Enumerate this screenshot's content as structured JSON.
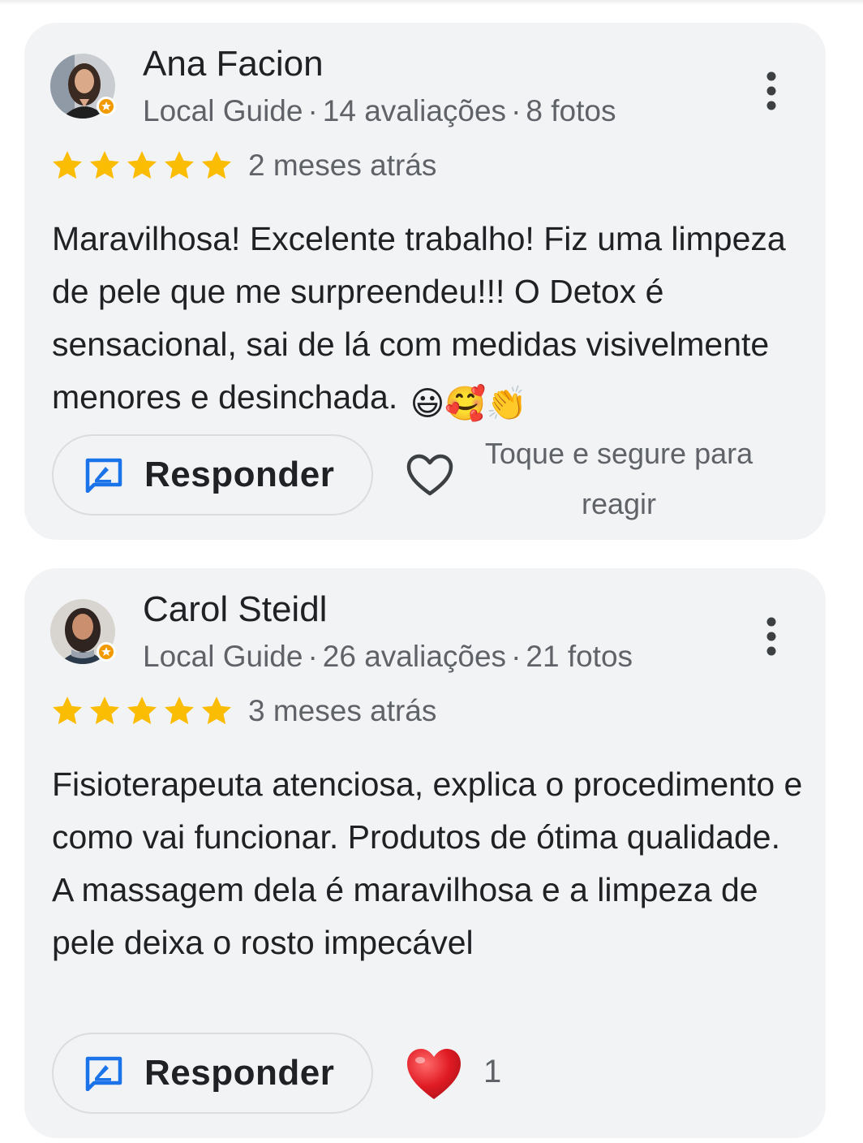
{
  "reviews": [
    {
      "name": "Ana Facion",
      "badge": "Local Guide",
      "reviews_count": "14 avaliações",
      "photos_count": "8 fotos",
      "rating": 5,
      "date": "2 meses atrás",
      "text": "Maravilhosa! Excelente trabalho! Fiz uma limpeza de pele que me surpreendeu!!! O Detox é sensacional, sai de lá com medidas visivelmente menores e desinchada.",
      "emojis": "😃🥰👏",
      "reply_label": "Responder",
      "react_hint": "Toque e segure para reagir"
    },
    {
      "name": "Carol Steidl",
      "badge": "Local Guide",
      "reviews_count": "26 avaliações",
      "photos_count": "21 fotos",
      "rating": 5,
      "date": "3 meses atrás",
      "text": "Fisioterapeuta atenciosa, explica o procedimento e como vai funcionar. Produtos de ótima qualidade. A massagem dela é maravilhosa e a limpeza de pele deixa o rosto impecável",
      "reply_label": "Responder",
      "reaction_count": "1"
    }
  ],
  "separator": "·",
  "icons": {
    "more": "more-vert-icon",
    "star": "star-icon",
    "reply": "reply-icon",
    "heart_outline": "heart-outline-icon",
    "heart_filled": "heart-filled-icon",
    "local_guide_badge": "local-guide-badge-icon"
  },
  "colors": {
    "star": "#fbbc04",
    "reply_icon": "#1a73e8",
    "heart": "#e01b24",
    "card_bg": "#f2f3f5",
    "secondary_text": "#5f6368"
  }
}
